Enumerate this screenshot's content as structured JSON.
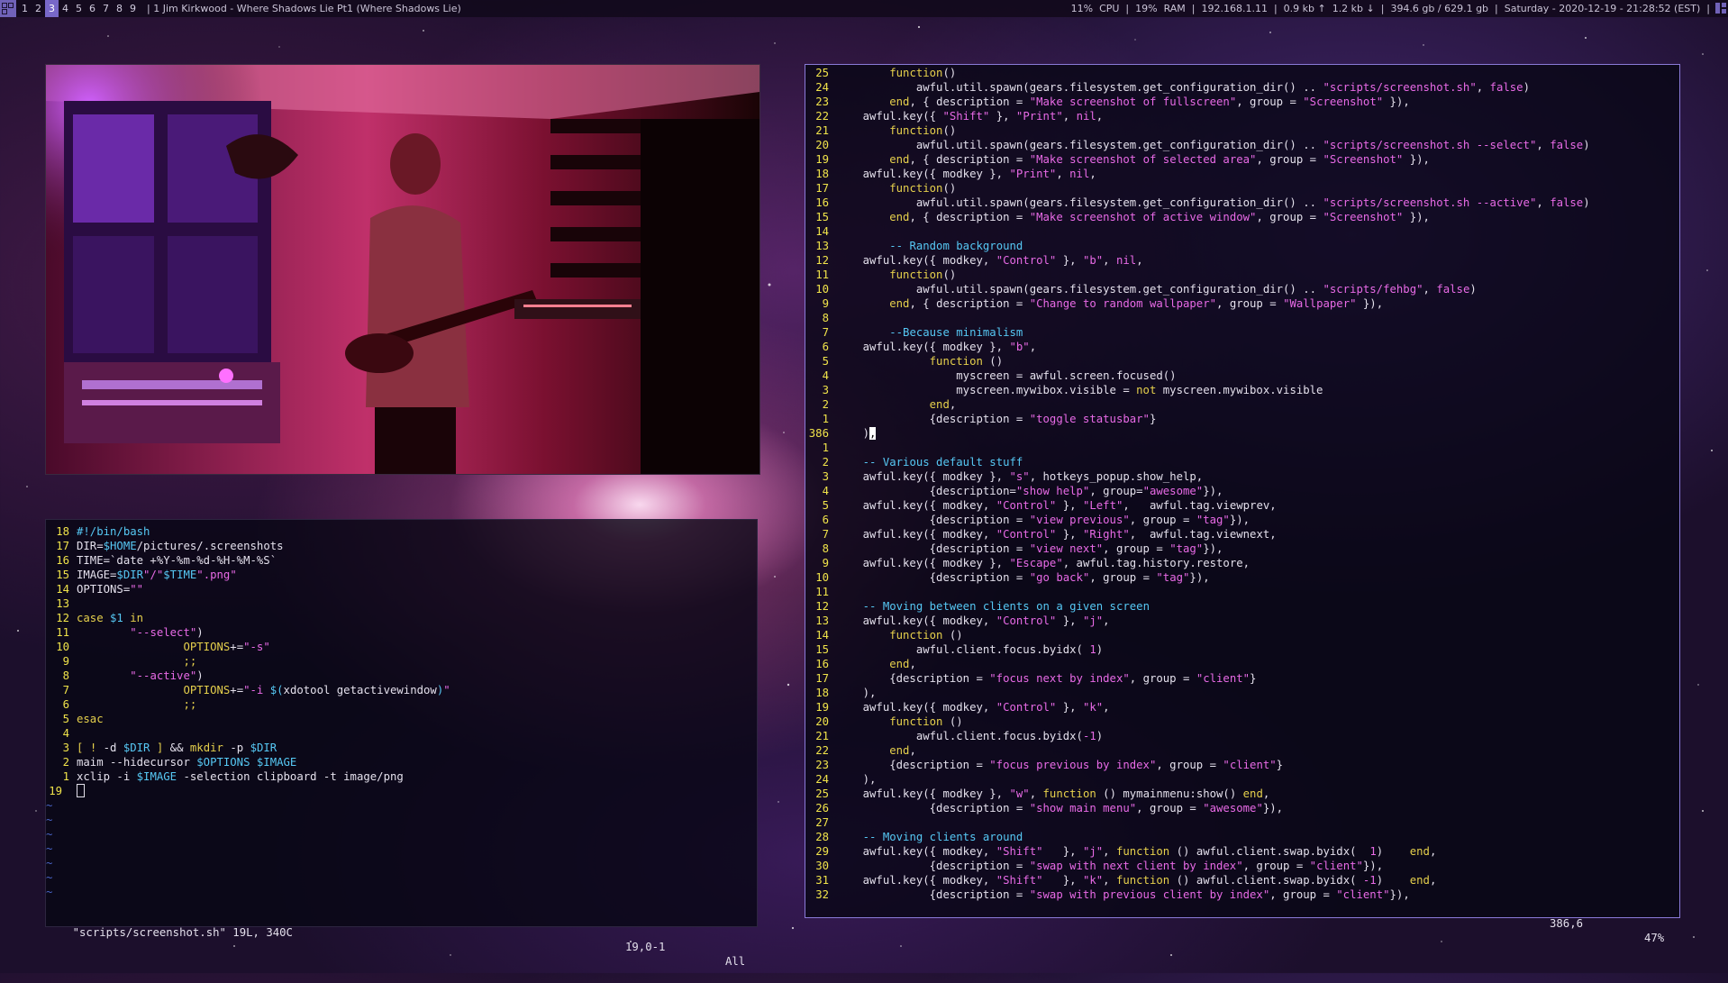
{
  "topbar": {
    "tags": [
      "1",
      "2",
      "3",
      "4",
      "5",
      "6",
      "7",
      "8",
      "9"
    ],
    "active_tag": "3",
    "window_title": "|  1 Jim Kirkwood - Where Shadows Lie Pt1 (Where Shadows Lie)",
    "sysinfo": "11%  CPU  |  19%  RAM  |  192.168.1.11  |  0.9 kb ↑  1.2 kb ↓  |  394.6 gb / 629.1 gb  |  Saturday - 2020-12-19 - 21:28:52 (EST)  |",
    "accent_color": "#7868c8"
  },
  "video": {
    "caption": ""
  },
  "left_vim": {
    "status_file": "\"scripts/screenshot.sh\" 19L, 340C",
    "status_pos": "19,0-1",
    "status_scroll": "All",
    "tilde": "~",
    "lines": [
      {
        "n": "18",
        "t": "#!/bin/bash"
      },
      {
        "n": "17",
        "t": "DIR=$HOME/pictures/.screenshots"
      },
      {
        "n": "16",
        "t": "TIME=`date +%Y-%m-%d-%H-%M-%S`"
      },
      {
        "n": "15",
        "t": "IMAGE=$DIR\"/\"$TIME\".png\""
      },
      {
        "n": "14",
        "t": "OPTIONS=\"\""
      },
      {
        "n": "13",
        "t": ""
      },
      {
        "n": "12",
        "t": "case $1 in"
      },
      {
        "n": "11",
        "t": "        \"--select\")"
      },
      {
        "n": "10",
        "t": "                OPTIONS+=\"-s\""
      },
      {
        "n": "9",
        "t": "                ;;"
      },
      {
        "n": "8",
        "t": "        \"--active\")"
      },
      {
        "n": "7",
        "t": "                OPTIONS+=\"-i $(xdotool getactivewindow)\""
      },
      {
        "n": "6",
        "t": "                ;;"
      },
      {
        "n": "5",
        "t": "esac"
      },
      {
        "n": "4",
        "t": ""
      },
      {
        "n": "3",
        "t": "[ ! -d $DIR ] && mkdir -p $DIR"
      },
      {
        "n": "2",
        "t": "maim --hidecursor $OPTIONS $IMAGE"
      },
      {
        "n": "1",
        "t": "xclip -i $IMAGE -selection clipboard -t image/png"
      },
      {
        "n": "19",
        "t": ""
      }
    ]
  },
  "right_vim": {
    "status_pos": "386,6",
    "status_scroll": "47%",
    "lines": [
      {
        "n": "25",
        "t": "        function()"
      },
      {
        "n": "24",
        "t": "            awful.util.spawn(gears.filesystem.get_configuration_dir() .. \"scripts/screenshot.sh\", false)"
      },
      {
        "n": "23",
        "t": "        end, { description = \"Make screenshot of fullscreen\", group = \"Screenshot\" }),"
      },
      {
        "n": "22",
        "t": "    awful.key({ \"Shift\" }, \"Print\", nil,"
      },
      {
        "n": "21",
        "t": "        function()"
      },
      {
        "n": "20",
        "t": "            awful.util.spawn(gears.filesystem.get_configuration_dir() .. \"scripts/screenshot.sh --select\", false)"
      },
      {
        "n": "19",
        "t": "        end, { description = \"Make screenshot of selected area\", group = \"Screenshot\" }),"
      },
      {
        "n": "18",
        "t": "    awful.key({ modkey }, \"Print\", nil,"
      },
      {
        "n": "17",
        "t": "        function()"
      },
      {
        "n": "16",
        "t": "            awful.util.spawn(gears.filesystem.get_configuration_dir() .. \"scripts/screenshot.sh --active\", false)"
      },
      {
        "n": "15",
        "t": "        end, { description = \"Make screenshot of active window\", group = \"Screenshot\" }),"
      },
      {
        "n": "14",
        "t": ""
      },
      {
        "n": "13",
        "t": "        -- Random background"
      },
      {
        "n": "12",
        "t": "    awful.key({ modkey, \"Control\" }, \"b\", nil,"
      },
      {
        "n": "11",
        "t": "        function()"
      },
      {
        "n": "10",
        "t": "            awful.util.spawn(gears.filesystem.get_configuration_dir() .. \"scripts/fehbg\", false)"
      },
      {
        "n": "9",
        "t": "        end, { description = \"Change to random wallpaper\", group = \"Wallpaper\" }),"
      },
      {
        "n": "8",
        "t": ""
      },
      {
        "n": "7",
        "t": "        --Because minimalism"
      },
      {
        "n": "6",
        "t": "    awful.key({ modkey }, \"b\","
      },
      {
        "n": "5",
        "t": "              function ()"
      },
      {
        "n": "4",
        "t": "                  myscreen = awful.screen.focused()"
      },
      {
        "n": "3",
        "t": "                  myscreen.mywibox.visible = not myscreen.mywibox.visible"
      },
      {
        "n": "2",
        "t": "              end,"
      },
      {
        "n": "1",
        "t": "              {description = \"toggle statusbar\"}"
      },
      {
        "n": "386",
        "t": "    ),"
      },
      {
        "n": "1",
        "t": ""
      },
      {
        "n": "2",
        "t": "    -- Various default stuff"
      },
      {
        "n": "3",
        "t": "    awful.key({ modkey }, \"s\", hotkeys_popup.show_help,"
      },
      {
        "n": "4",
        "t": "              {description=\"show help\", group=\"awesome\"}),"
      },
      {
        "n": "5",
        "t": "    awful.key({ modkey, \"Control\" }, \"Left\",   awful.tag.viewprev,"
      },
      {
        "n": "6",
        "t": "              {description = \"view previous\", group = \"tag\"}),"
      },
      {
        "n": "7",
        "t": "    awful.key({ modkey, \"Control\" }, \"Right\",  awful.tag.viewnext,"
      },
      {
        "n": "8",
        "t": "              {description = \"view next\", group = \"tag\"}),"
      },
      {
        "n": "9",
        "t": "    awful.key({ modkey }, \"Escape\", awful.tag.history.restore,"
      },
      {
        "n": "10",
        "t": "              {description = \"go back\", group = \"tag\"}),"
      },
      {
        "n": "11",
        "t": ""
      },
      {
        "n": "12",
        "t": "    -- Moving between clients on a given screen"
      },
      {
        "n": "13",
        "t": "    awful.key({ modkey, \"Control\" }, \"j\","
      },
      {
        "n": "14",
        "t": "        function ()"
      },
      {
        "n": "15",
        "t": "            awful.client.focus.byidx( 1)"
      },
      {
        "n": "16",
        "t": "        end,"
      },
      {
        "n": "17",
        "t": "        {description = \"focus next by index\", group = \"client\"}"
      },
      {
        "n": "18",
        "t": "    ),"
      },
      {
        "n": "19",
        "t": "    awful.key({ modkey, \"Control\" }, \"k\","
      },
      {
        "n": "20",
        "t": "        function ()"
      },
      {
        "n": "21",
        "t": "            awful.client.focus.byidx(-1)"
      },
      {
        "n": "22",
        "t": "        end,"
      },
      {
        "n": "23",
        "t": "        {description = \"focus previous by index\", group = \"client\"}"
      },
      {
        "n": "24",
        "t": "    ),"
      },
      {
        "n": "25",
        "t": "    awful.key({ modkey }, \"w\", function () mymainmenu:show() end,"
      },
      {
        "n": "26",
        "t": "              {description = \"show main menu\", group = \"awesome\"}),"
      },
      {
        "n": "27",
        "t": ""
      },
      {
        "n": "28",
        "t": "    -- Moving clients around"
      },
      {
        "n": "29",
        "t": "    awful.key({ modkey, \"Shift\"   }, \"j\", function () awful.client.swap.byidx(  1)    end,"
      },
      {
        "n": "30",
        "t": "              {description = \"swap with next client by index\", group = \"client\"}),"
      },
      {
        "n": "31",
        "t": "    awful.key({ modkey, \"Shift\"   }, \"k\", function () awful.client.swap.byidx( -1)    end,"
      },
      {
        "n": "32",
        "t": "              {description = \"swap with previous client by index\", group = \"client\"}),"
      }
    ]
  }
}
